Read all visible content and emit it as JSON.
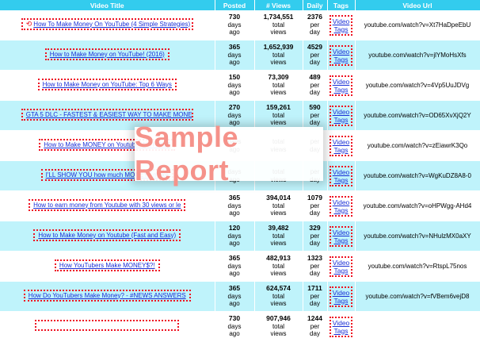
{
  "header": {
    "video_title": "Video Title",
    "posted": "Posted",
    "views": "# Views",
    "daily": "Daily",
    "tags": "Tags",
    "video_url": "Video Url"
  },
  "units": {
    "days": "days",
    "ago": "ago",
    "total": "total",
    "views": "views",
    "per": "per",
    "day": "day"
  },
  "tags_label": {
    "line1": "Video",
    "line2": "Tags"
  },
  "rows": [
    {
      "title": "How To Make Money On YouTube (4 Simple Strategies)",
      "posted": "730",
      "views": "1,734,551",
      "daily": "2376",
      "url": "youtube.com/watch?v=Xt7HaDpeEbU"
    },
    {
      "title": "How to Make Money on YouTube! (2016)",
      "posted": "365",
      "views": "1,652,939",
      "daily": "4529",
      "url": "youtube.com/watch?v=jlYMoHsXfs"
    },
    {
      "title": "How to Make Money on YouTube: Top 6 Ways",
      "posted": "150",
      "views": "73,309",
      "daily": "489",
      "url": "youtube.com/watch?v=4Vp5UuJDVg"
    },
    {
      "title": "GTA 5 DLC - FASTEST & EASIEST WAY TO MAKE MONE",
      "posted": "270",
      "views": "159,261",
      "daily": "590",
      "url": "youtube.com/watch?v=OD65XvXjQ2Y"
    },
    {
      "title": "How to Make MONEY on Youtube WITHOUT",
      "posted": "",
      "views": "",
      "daily": "",
      "url": "youtube.com/watch?v=zEiawrK3Qo"
    },
    {
      "title": "I'LL SHOW YOU how much MONEY I make",
      "posted": "",
      "views": "",
      "daily": "",
      "url": "youtube.com/watch?v=WgKuDZ8A8-0"
    },
    {
      "title": "How to earn money from Youtube with 30 views or le",
      "posted": "365",
      "views": "394,014",
      "daily": "1079",
      "url": "youtube.com/watch?v=oHPWgg-AHd4"
    },
    {
      "title": "How to Make Money on Youtube (Fast and Easy)",
      "posted": "120",
      "views": "39,482",
      "daily": "329",
      "url": "youtube.com/watch?v=NHulzMX0aXY"
    },
    {
      "title": "How YouTubers Make MONEY$?!",
      "posted": "365",
      "views": "482,913",
      "daily": "1323",
      "url": "youtube.com/watch?v=RtspL75nos"
    },
    {
      "title": "How Do YouTubers Make Money? - #NEWS ANSWERS",
      "posted": "365",
      "views": "624,574",
      "daily": "1711",
      "url": "youtube.com/watch?v=fVBem6vejD8"
    },
    {
      "title": "",
      "posted": "730",
      "views": "907,946",
      "daily": "1244",
      "url": ""
    }
  ],
  "watermark": "Sample Report",
  "colors": {
    "header_bg": "#33ccee",
    "row_alt_bg": "#bff3fb",
    "link": "#1a2fd6",
    "dotted_border": "#ee1122",
    "watermark_text": "#f5928a"
  }
}
